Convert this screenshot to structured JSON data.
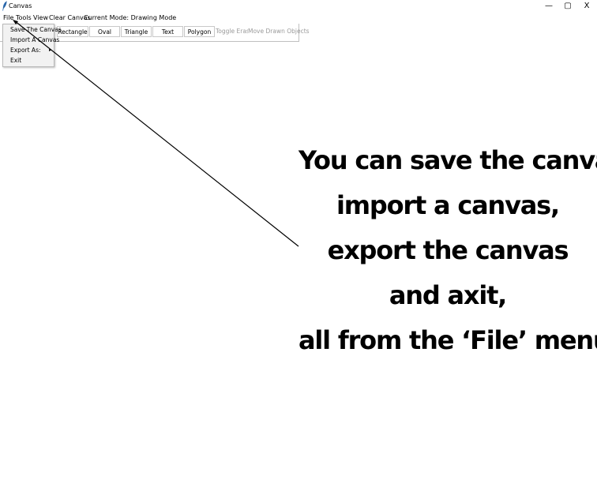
{
  "window": {
    "title": "Canvas",
    "controls": {
      "minimize": "—",
      "maximize": "▢",
      "close": "X"
    }
  },
  "menubar": {
    "file": "File",
    "tools": "Tools",
    "view": "View",
    "clear": "Clear Canvas",
    "mode": "Current Mode: Drawing Mode"
  },
  "toolbar": {
    "rectangle": "Rectangle",
    "oval": "Oval",
    "triangle": "Triangle",
    "text": "Text",
    "polygon": "Polygon",
    "toggle_eraser": "Toggle Eraser",
    "move_drawn": "Move Drawn Objects"
  },
  "file_menu": {
    "items": [
      "Save The Canvas",
      "Import A Canvas",
      "Export As:",
      "Exit"
    ],
    "submenu_arrow": "▸"
  },
  "annotation": {
    "lines": [
      "You can save the canvas,",
      "import a canvas,",
      "export the canvas",
      "and axit,",
      "all from the ‘File’ menu"
    ]
  }
}
